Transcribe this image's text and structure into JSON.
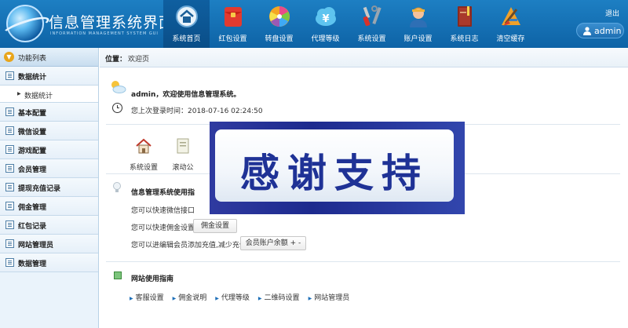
{
  "app": {
    "title": "信息管理系统界面",
    "subtitle": "INFORMATION MANAGEMENT SYSTEM GUI"
  },
  "nav": {
    "items": [
      {
        "label": "系统首页",
        "icon": "home-icon",
        "active": true
      },
      {
        "label": "红包设置",
        "icon": "red-packet-icon",
        "active": false
      },
      {
        "label": "转盘设置",
        "icon": "wheel-icon",
        "active": false
      },
      {
        "label": "代理等级",
        "icon": "yen-cloud-icon",
        "active": false
      },
      {
        "label": "系统设置",
        "icon": "tools-icon",
        "active": false
      },
      {
        "label": "账户设置",
        "icon": "user-account-icon",
        "active": false
      },
      {
        "label": "系统日志",
        "icon": "log-book-icon",
        "active": false
      },
      {
        "label": "清空缓存",
        "icon": "clear-cache-icon",
        "active": false
      }
    ],
    "logout": "退出",
    "user": "admin"
  },
  "sidebar": {
    "header": "功能列表",
    "items": [
      {
        "label": "数据统计"
      },
      {
        "label": "基本配置"
      },
      {
        "label": "微信设置"
      },
      {
        "label": "游戏配置"
      },
      {
        "label": "会员管理"
      },
      {
        "label": "提现充值记录"
      },
      {
        "label": "佣金管理"
      },
      {
        "label": "红包记录"
      },
      {
        "label": "网站管理员"
      },
      {
        "label": "数据管理"
      }
    ],
    "sub_item": "数据统计"
  },
  "breadcrumb": {
    "label": "位置：",
    "page": "欢迎页"
  },
  "welcome": {
    "user": "admin",
    "message": "，欢迎使用信息管理系统。",
    "last_login": "您上次登录时间：2018-07-16 02:24:50"
  },
  "shortcuts": [
    {
      "label": "系统设置",
      "icon": "house-icon"
    },
    {
      "label": "滚动公",
      "icon": "notice-icon"
    }
  ],
  "guide": {
    "title": "信息管理系统使用指",
    "line1": "您可以快速微信接口",
    "line2": "您可以快速佣金设置",
    "line2_button": "佣金设置",
    "line3": "您可以进编辑会员添加充值,减少充值",
    "line3_button": "会员账户余额 + -"
  },
  "site_guide": {
    "title": "网站使用指南",
    "links": [
      "客服设置",
      "佣金说明",
      "代理等级",
      "二维码设置",
      "网站管理员"
    ]
  },
  "banner": {
    "text": "感谢支持"
  },
  "colors": {
    "header_blue": "#1170b6",
    "banner_blue": "#1f3296"
  }
}
